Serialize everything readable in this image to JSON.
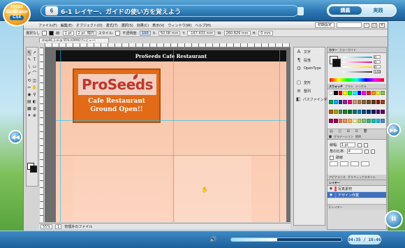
{
  "player": {
    "badge": {
      "line1": "ADOBE",
      "line2": "Illustrator",
      "number": "CS4"
    },
    "lesson": {
      "number": "6",
      "title": "6-1 レイヤー、ガイドの使い方を覚えよう"
    },
    "mode": {
      "explain": "講義",
      "practice": "実践"
    },
    "time": "04:35 / 10:46",
    "progress": 0.42,
    "pause_label": "II",
    "prev_label": "◀◀",
    "next_label": "▶▶"
  },
  "illustrator": {
    "menu": [
      "ファイル(F)",
      "編集(E)",
      "オブジェクト(O)",
      "書式(T)",
      "選択(S)",
      "効果(C)",
      "表示(V)",
      "ウィンドウ(W)",
      "ヘルプ(H)"
    ],
    "workspace": "初期設定",
    "control": {
      "selection": "選択なし",
      "stroke_label": "線:",
      "stroke_value": "1 pt",
      "brush": "2 pt. 楕円",
      "style_label": "スタイル:",
      "opacity_label": "不透明度:",
      "opacity_value": "100",
      "x_label": "X:",
      "x_value": "50.08 mm",
      "y_label": "Y:",
      "y_value": "-167.433 mm",
      "w_label": "W:",
      "w_value": "260.829 mm",
      "h_label": "H:",
      "h_value": "0 mm"
    },
    "doc_tab": "shop06_1.ai @ 55% (CMYK/プレビュー)",
    "tools": [
      "↖",
      "↗",
      "✎",
      "T",
      "\\",
      "▭",
      "✐",
      "⌒",
      "⟲",
      "◫",
      "✂",
      "✋",
      "◉",
      "⚲",
      "▤",
      "◐",
      "▦",
      "◍",
      "✦",
      "⊕"
    ],
    "artboard": {
      "header": "ProSeeds Cafe Restaurant",
      "logo_word": "ProSeeds",
      "logo_sub1": "Cafe Restaurant",
      "logo_sub2": "Ground Open!!"
    },
    "status": {
      "zoom": "55%",
      "page": "1",
      "status_text": "管理外のファイル"
    },
    "mid_panel": {
      "items": [
        {
          "icon": "A",
          "label": "文字",
          "name": "character"
        },
        {
          "icon": "¶",
          "label": "段落",
          "name": "paragraph"
        },
        {
          "icon": "O",
          "label": "OpenType",
          "name": "opentype"
        },
        {
          "icon": "▢",
          "label": "変形",
          "name": "transform"
        },
        {
          "icon": "≡",
          "label": "整列",
          "name": "align"
        },
        {
          "icon": "◧",
          "label": "パスファインダー",
          "name": "pathfinder"
        }
      ]
    },
    "color_panel": {
      "tabs": [
        "カラー",
        "カラーガイド"
      ],
      "channels": [
        {
          "name": "C",
          "color": "#00aeef",
          "value": "0"
        },
        {
          "name": "M",
          "color": "#ec008c",
          "value": "0"
        },
        {
          "name": "Y",
          "color": "#ffd400",
          "value": "0"
        },
        {
          "name": "K",
          "color": "#333333",
          "value": "100"
        }
      ]
    },
    "swatch_panel": {
      "tabs": [
        "スウォッチ",
        "ブラシ",
        "シンボル"
      ],
      "colors": [
        "#ffffff",
        "#000000",
        "#ff0000",
        "#ffff00",
        "#00ff00",
        "#00ffff",
        "#0000ff",
        "#ff00ff",
        "#ed1c24",
        "#f7941d",
        "#fff200",
        "#8dc63f",
        "#00a651",
        "#00aeef",
        "#2e3192",
        "#92278f",
        "#ec008c",
        "#c69c6d",
        "#a67c52",
        "#8c6239",
        "#754c24",
        "#603913",
        "#9e0b0f",
        "#a0410d",
        "#a3620a",
        "#aba000",
        "#598527",
        "#1a7b30",
        "#007236",
        "#00746b",
        "#0076a3",
        "#004a80",
        "#003471",
        "#1b1464",
        "#440e62",
        "#630460",
        "#9e005d",
        "#9e0039",
        "#f26c4f",
        "#f68e56",
        "#fbaf5d",
        "#fff799",
        "#acd373",
        "#7cc576",
        "#3bb878",
        "#1abbb4",
        "#00bff3",
        "#448ccb"
      ],
      "foot": "▤ ◫ ⊞ ⊟ 🗑"
    },
    "stroke_panel": {
      "tabs": [
        "線",
        "グラデーション",
        "透明"
      ],
      "weight_label": "線幅:",
      "weight_value": "1 pt",
      "miter_label": "角の比率:",
      "miter_value": "4",
      "dash_label": "破線"
    },
    "layers_panel": {
      "tabs": [
        "アピアランス",
        "グラフィックスタイル"
      ],
      "title": "レイヤー",
      "layers": [
        {
          "name": "写真素材",
          "color": "#ff4d4d",
          "selected": false
        },
        {
          "name": "デザイン作業",
          "color": "#4d7fff",
          "selected": true
        }
      ],
      "foot": "2 レイヤー"
    }
  }
}
